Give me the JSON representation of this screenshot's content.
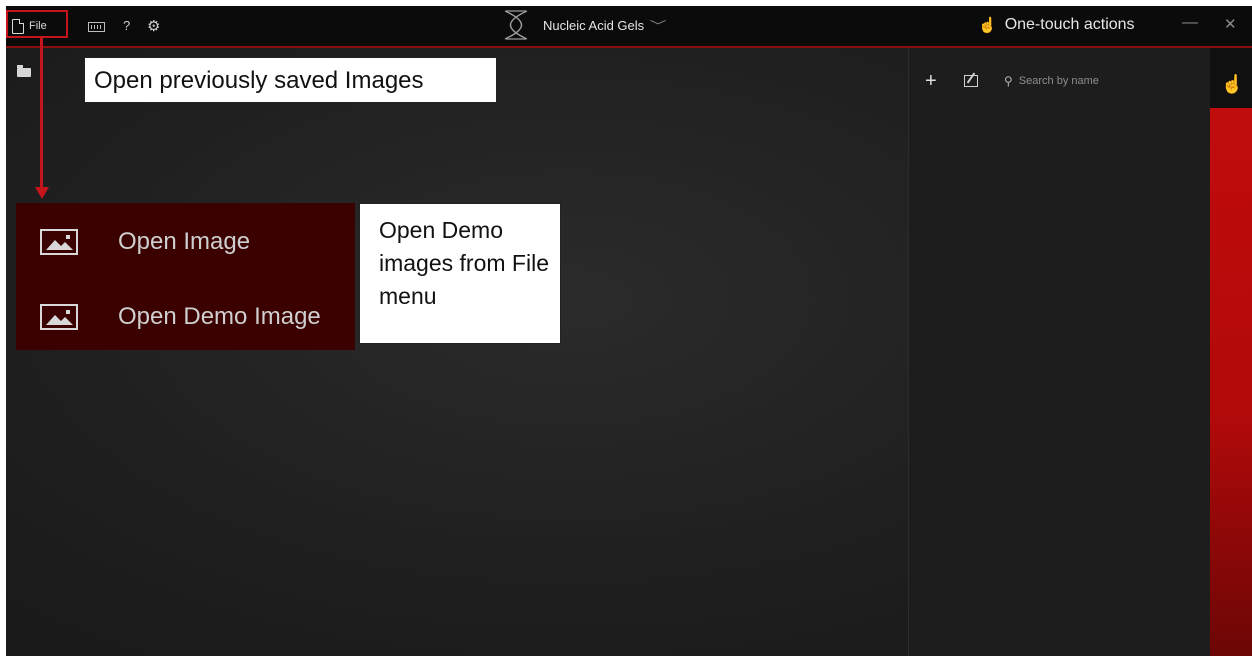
{
  "titlebar": {
    "file_label": "File",
    "help_label": "?",
    "gear_glyph": "⚙",
    "app_title": "Nucleic Acid Gels",
    "title_chevron": "﹀",
    "one_touch_label": "One-touch actions",
    "minimize_glyph": "—",
    "close_glyph": "✕"
  },
  "right_panel": {
    "add_glyph": "+",
    "search_placeholder": "Search by name"
  },
  "file_menu": {
    "items": [
      {
        "label": "Open Image",
        "icon": "image-icon"
      },
      {
        "label": "Open Demo Image",
        "icon": "image-icon"
      }
    ]
  },
  "callouts": {
    "top": "Open previously saved Images",
    "side": "Open Demo images from File menu"
  },
  "colors": {
    "accent_red": "#c4151c",
    "menu_bg": "#3b0000",
    "titlebar_bg": "#0b0b0b"
  }
}
